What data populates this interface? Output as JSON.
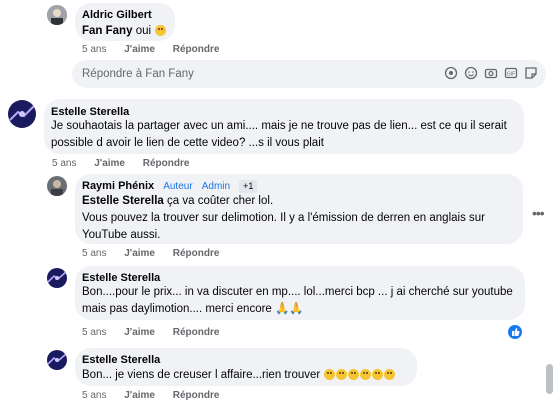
{
  "comments": [
    {
      "author": "Aldric Gilbert",
      "mention": "Fan Fany",
      "text": "oui",
      "time": "5 ans",
      "like": "J'aime",
      "reply": "Répondre"
    },
    {
      "author": "Estelle Sterella",
      "text": "Je souhaotais la partager avec un ami.... mais je ne trouve pas de lien... est ce qu il serait possible d avoir le lien de cette video? ...s il vous plait",
      "time": "5 ans",
      "like": "J'aime",
      "reply": "Répondre"
    },
    {
      "author": "Raymi Phénix",
      "badge_author": "Auteur",
      "badge_admin": "Admin",
      "badge_count": "+1",
      "mention": "Estelle Sterella",
      "text_line1": "ça va coûter cher lol.",
      "text_line2": "Vous pouvez la trouver sur delimotion. Il y a l'émission de derren en anglais sur YouTube aussi.",
      "time": "5 ans",
      "like": "J'aime",
      "reply": "Répondre"
    },
    {
      "author": "Estelle Sterella",
      "text": "Bon....pour le prix... in va discuter en mp.... lol...merci bcp ... j ai cherché sur youtube mais pas daylimotion.... merci encore",
      "time": "5 ans",
      "like": "J'aime",
      "reply": "Répondre"
    },
    {
      "author": "Estelle Sterella",
      "text": "Bon... je viens de creuser l affaire...rien trouver",
      "time": "5 ans",
      "like": "J'aime",
      "reply": "Répondre"
    }
  ],
  "reply_box": {
    "placeholder": "Répondre à Fan Fany"
  },
  "icons": {
    "more": "more-options-icon",
    "like_reaction": "like-reaction-icon",
    "reply_tools": [
      "sticker-icon",
      "emoji-icon",
      "camera-icon",
      "gif-icon",
      "sticker-alt-icon"
    ]
  },
  "colors": {
    "link_blue": "#1b74e4",
    "bubble": "#f0f2f5",
    "meta": "#65676b"
  }
}
